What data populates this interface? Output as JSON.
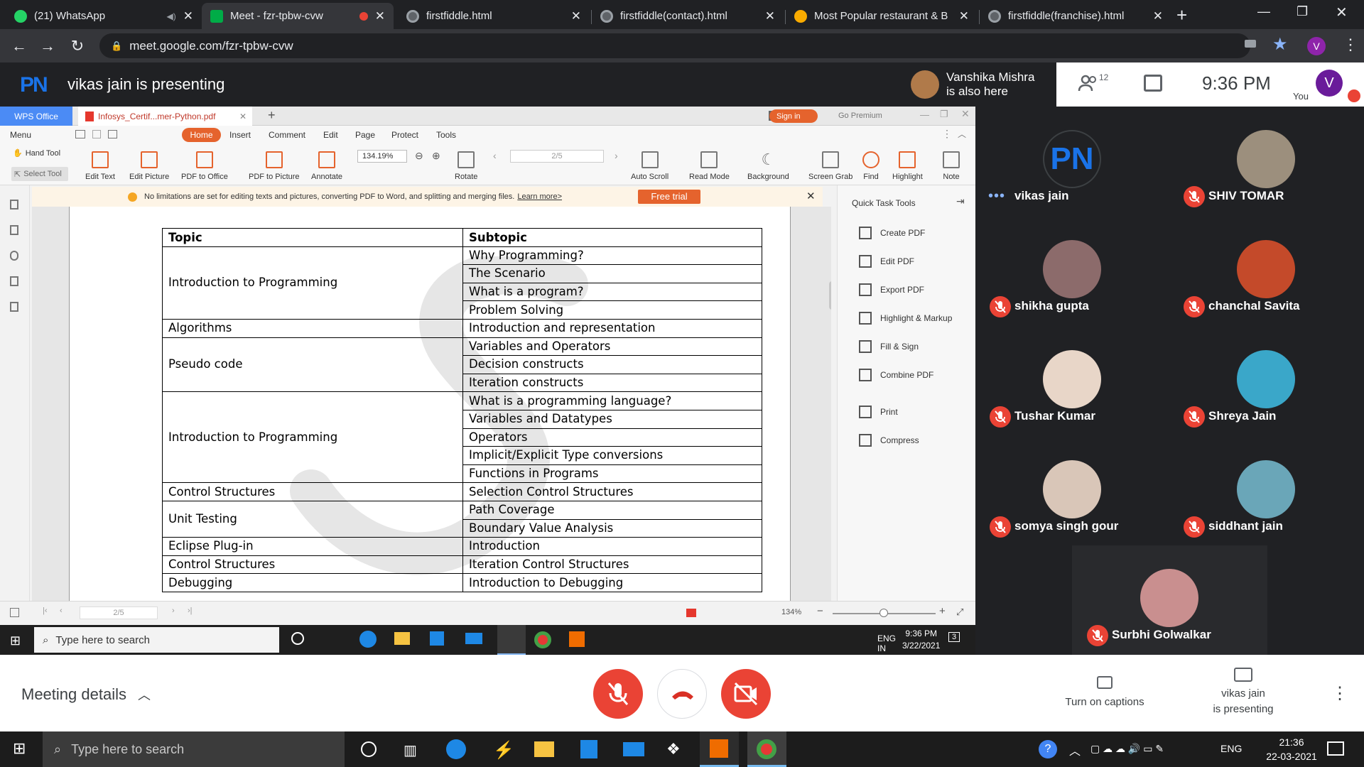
{
  "browser": {
    "tabs": [
      {
        "label": "(21) WhatsApp",
        "favicon_color": "#25d366",
        "active": false
      },
      {
        "label": "Meet - fzr-tpbw-cvw",
        "favicon_color": "#00ac47",
        "active": true
      },
      {
        "label": "firstfiddle.html",
        "favicon_color": "#9aa0a6",
        "active": false
      },
      {
        "label": "firstfiddle(contact).html",
        "favicon_color": "#9aa0a6",
        "active": false
      },
      {
        "label": "Most Popular restaurant & B",
        "favicon_color": "#f9ab00",
        "active": false
      },
      {
        "label": "firstfiddle(franchise).html",
        "favicon_color": "#9aa0a6",
        "active": false
      }
    ],
    "url": "meet.google.com/fzr-tpbw-cvw",
    "profile_initial": "V"
  },
  "meet": {
    "presenter_initials": "PN",
    "presenting_title": "vikas jain is presenting",
    "also_here_name": "Vanshika Mishra",
    "also_here_text": "is also here",
    "participant_count": "12",
    "time": "9:36 PM",
    "you_label": "You",
    "you_initial": "V",
    "meeting_details": "Meeting details",
    "captions_label": "Turn on captions",
    "presenting_label_1": "vikas jain",
    "presenting_label_2": "is presenting"
  },
  "participants": [
    {
      "name": "vikas jain",
      "initials": "PN",
      "muted": false
    },
    {
      "name": "SHIV TOMAR",
      "muted": true
    },
    {
      "name": "shikha gupta",
      "muted": true
    },
    {
      "name": "chanchal Savita",
      "muted": true
    },
    {
      "name": "Tushar Kumar",
      "muted": true
    },
    {
      "name": "Shreya Jain",
      "muted": true
    },
    {
      "name": "somya singh gour",
      "muted": true
    },
    {
      "name": "siddhant jain",
      "muted": true
    },
    {
      "name": "Surbhi Golwalkar",
      "muted": true
    }
  ],
  "wps": {
    "brand": "WPS Office",
    "doc_tab": "Infosys_Certif...mer-Python.pdf",
    "sign_in": "Sign in",
    "go_premium": "Go Premium",
    "menu": [
      "Menu",
      "Home",
      "Insert",
      "Comment",
      "Edit",
      "Page",
      "Protect",
      "Tools"
    ],
    "tools": {
      "hand": "Hand Tool",
      "select": "Select Tool",
      "edit_text": "Edit Text",
      "edit_picture": "Edit Picture",
      "pdf_to_office": "PDF to Office",
      "pdf_to_picture": "PDF to Picture",
      "annotate": "Annotate",
      "zoom": "134.19%",
      "rotate": "Rotate",
      "page": "2/5",
      "auto_scroll": "Auto Scroll",
      "read_mode": "Read Mode",
      "background": "Background",
      "screen_grab": "Screen Grab",
      "find": "Find",
      "highlight": "Highlight",
      "note": "Note"
    },
    "notice_text": "No limitations are set for editing texts and pictures, converting PDF to Word, and splitting and merging files.",
    "notice_link": "Learn more>",
    "free_trial": "Free trial",
    "quick_tools_title": "Quick Task Tools",
    "quick_tools": [
      "Create PDF",
      "Edit PDF",
      "Export PDF",
      "Highlight & Markup",
      "Fill & Sign",
      "Combine PDF",
      "Print",
      "Compress"
    ],
    "status_page": "2/5",
    "status_zoom": "134%"
  },
  "table": {
    "headers": [
      "Topic",
      "Subtopic"
    ],
    "rows": [
      {
        "topic": "Introduction to Programming",
        "subs": [
          "Why Programming?",
          "The Scenario",
          "What is a program?",
          "Problem Solving"
        ]
      },
      {
        "topic": "Algorithms",
        "subs": [
          "Introduction and representation"
        ]
      },
      {
        "topic": "Pseudo code",
        "subs": [
          "Variables and Operators",
          "Decision constructs",
          "Iteration constructs"
        ]
      },
      {
        "topic": "Introduction to Programming",
        "subs": [
          "What is a programming language?",
          "Variables and Datatypes",
          "Operators",
          "Implicit/Explicit Type conversions",
          "Functions in Programs"
        ]
      },
      {
        "topic": "Control Structures",
        "subs": [
          "Selection Control Structures"
        ]
      },
      {
        "topic": "Unit Testing",
        "subs": [
          "Path Coverage",
          "Boundary Value Analysis"
        ]
      },
      {
        "topic": "Eclipse Plug-in",
        "subs": [
          "Introduction"
        ]
      },
      {
        "topic": "Control Structures",
        "subs": [
          "Iteration Control Structures"
        ]
      },
      {
        "topic": "Debugging",
        "subs": [
          "Introduction to Debugging"
        ]
      }
    ]
  },
  "inner_taskbar": {
    "search_placeholder": "Type here to search",
    "lang": "ENG",
    "region": "IN",
    "time": "9:36 PM",
    "date": "3/22/2021",
    "notif_count": "3"
  },
  "taskbar": {
    "search_placeholder": "Type here to search",
    "lang": "ENG",
    "time": "21:36",
    "date": "22-03-2021"
  },
  "colors": {
    "meet_red": "#ea4335",
    "meet_dark": "#202124",
    "wps_orange": "#e5632d",
    "accent_blue": "#1a73e8"
  }
}
